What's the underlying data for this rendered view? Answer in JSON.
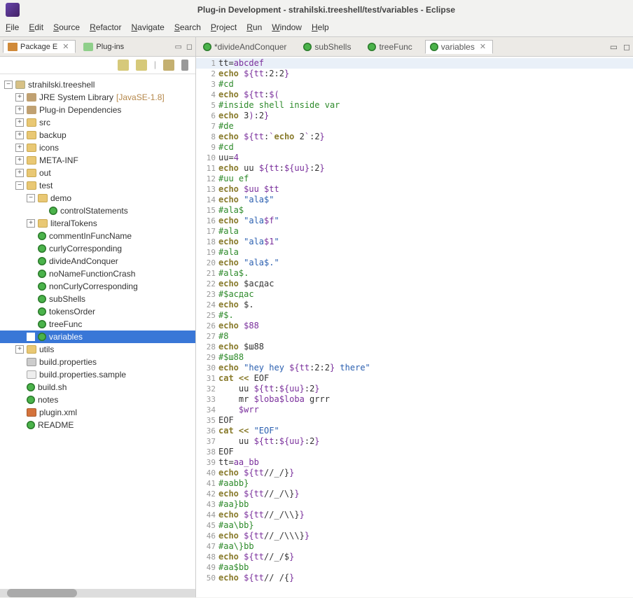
{
  "title": "Plug-in Development - strahilski.treeshell/test/variables - Eclipse",
  "menu": [
    "File",
    "Edit",
    "Source",
    "Refactor",
    "Navigate",
    "Search",
    "Project",
    "Run",
    "Window",
    "Help"
  ],
  "sidebar": {
    "tabs": [
      {
        "label": "Package E",
        "active": true
      },
      {
        "label": "Plug-ins",
        "active": false
      }
    ],
    "root": "strahilski.treeshell",
    "jre": {
      "label": "JRE System Library",
      "suffix": "[JavaSE-1.8]"
    },
    "plugin_dep": "Plug-in Dependencies",
    "folders": [
      "src",
      "backup",
      "icons",
      "META-INF",
      "out",
      "test"
    ],
    "demo": "demo",
    "demo_child": "controlStatements",
    "literal": "literalTokens",
    "test_files": [
      "commentInFuncName",
      "curlyCorresponding",
      "divideAndConquer",
      "noNameFunctionCrash",
      "nonCurlyCorresponding",
      "subShells",
      "tokensOrder",
      "treeFunc",
      "variables"
    ],
    "utils": "utils",
    "root_files": [
      {
        "label": "build.properties",
        "type": "prop"
      },
      {
        "label": "build.properties.sample",
        "type": "file"
      },
      {
        "label": "build.sh",
        "type": "leaf"
      },
      {
        "label": "notes",
        "type": "leaf"
      },
      {
        "label": "plugin.xml",
        "type": "xml"
      },
      {
        "label": "README",
        "type": "leaf"
      }
    ]
  },
  "editor_tabs": [
    {
      "label": "*divideAndConquer",
      "active": false
    },
    {
      "label": "subShells",
      "active": false
    },
    {
      "label": "treeFunc",
      "active": false
    },
    {
      "label": "variables",
      "active": true
    }
  ],
  "code": [
    {
      "n": 1,
      "hl": true,
      "segs": [
        {
          "t": "tt",
          "c": "plain"
        },
        {
          "t": "=",
          "c": "plain"
        },
        {
          "t": "abcdef",
          "c": "var"
        }
      ]
    },
    {
      "n": 2,
      "segs": [
        {
          "t": "echo ",
          "c": "cmd"
        },
        {
          "t": "${tt",
          "c": "var"
        },
        {
          "t": ":2:2",
          "c": "plain"
        },
        {
          "t": "}",
          "c": "var"
        }
      ]
    },
    {
      "n": 3,
      "segs": [
        {
          "t": "#cd",
          "c": "com"
        }
      ]
    },
    {
      "n": 4,
      "segs": [
        {
          "t": "echo ",
          "c": "cmd"
        },
        {
          "t": "${tt",
          "c": "var"
        },
        {
          "t": ":",
          "c": "plain"
        },
        {
          "t": "$(",
          "c": "var"
        }
      ]
    },
    {
      "n": 5,
      "segs": [
        {
          "t": "#inside shell inside var",
          "c": "com"
        }
      ]
    },
    {
      "n": 6,
      "segs": [
        {
          "t": "echo ",
          "c": "cmd"
        },
        {
          "t": "3",
          "c": "plain"
        },
        {
          "t": ")",
          "c": "var"
        },
        {
          "t": ":2",
          "c": "plain"
        },
        {
          "t": "}",
          "c": "var"
        }
      ]
    },
    {
      "n": 7,
      "segs": [
        {
          "t": "#de",
          "c": "com"
        }
      ]
    },
    {
      "n": 8,
      "segs": [
        {
          "t": "echo ",
          "c": "cmd"
        },
        {
          "t": "${tt",
          "c": "var"
        },
        {
          "t": ":",
          "c": "plain"
        },
        {
          "t": "`",
          "c": "var"
        },
        {
          "t": "echo ",
          "c": "cmd"
        },
        {
          "t": "2",
          "c": "plain"
        },
        {
          "t": "`",
          "c": "var"
        },
        {
          "t": ":2",
          "c": "plain"
        },
        {
          "t": "}",
          "c": "var"
        }
      ]
    },
    {
      "n": 9,
      "segs": [
        {
          "t": "#cd",
          "c": "com"
        }
      ]
    },
    {
      "n": 10,
      "segs": [
        {
          "t": "uu",
          "c": "plain"
        },
        {
          "t": "=",
          "c": "plain"
        },
        {
          "t": "4",
          "c": "var"
        }
      ]
    },
    {
      "n": 11,
      "segs": [
        {
          "t": "echo ",
          "c": "cmd"
        },
        {
          "t": "uu ",
          "c": "plain"
        },
        {
          "t": "${tt",
          "c": "var"
        },
        {
          "t": ":",
          "c": "plain"
        },
        {
          "t": "${uu}",
          "c": "var"
        },
        {
          "t": ":2",
          "c": "plain"
        },
        {
          "t": "}",
          "c": "var"
        }
      ]
    },
    {
      "n": 12,
      "segs": [
        {
          "t": "#uu ef",
          "c": "com"
        }
      ]
    },
    {
      "n": 13,
      "segs": [
        {
          "t": "echo ",
          "c": "cmd"
        },
        {
          "t": "$uu $tt",
          "c": "var"
        }
      ]
    },
    {
      "n": 14,
      "segs": [
        {
          "t": "echo ",
          "c": "cmd"
        },
        {
          "t": "\"ala$\"",
          "c": "str"
        }
      ]
    },
    {
      "n": 15,
      "segs": [
        {
          "t": "#ala$",
          "c": "com"
        }
      ]
    },
    {
      "n": 16,
      "segs": [
        {
          "t": "echo ",
          "c": "cmd"
        },
        {
          "t": "\"ala",
          "c": "str"
        },
        {
          "t": "$f",
          "c": "var"
        },
        {
          "t": "\"",
          "c": "str"
        }
      ]
    },
    {
      "n": 17,
      "segs": [
        {
          "t": "#ala",
          "c": "com"
        }
      ]
    },
    {
      "n": 18,
      "segs": [
        {
          "t": "echo ",
          "c": "cmd"
        },
        {
          "t": "\"ala",
          "c": "str"
        },
        {
          "t": "$1",
          "c": "var"
        },
        {
          "t": "\"",
          "c": "str"
        }
      ]
    },
    {
      "n": 19,
      "segs": [
        {
          "t": "#ala",
          "c": "com"
        }
      ]
    },
    {
      "n": 20,
      "segs": [
        {
          "t": "echo ",
          "c": "cmd"
        },
        {
          "t": "\"ala$.\"",
          "c": "str"
        }
      ]
    },
    {
      "n": 21,
      "segs": [
        {
          "t": "#ala$.",
          "c": "com"
        }
      ]
    },
    {
      "n": 22,
      "segs": [
        {
          "t": "echo ",
          "c": "cmd"
        },
        {
          "t": "$асдас",
          "c": "plain"
        }
      ]
    },
    {
      "n": 23,
      "segs": [
        {
          "t": "#$асдас",
          "c": "com"
        }
      ]
    },
    {
      "n": 24,
      "segs": [
        {
          "t": "echo ",
          "c": "cmd"
        },
        {
          "t": "$.",
          "c": "plain"
        }
      ]
    },
    {
      "n": 25,
      "segs": [
        {
          "t": "#$.",
          "c": "com"
        }
      ]
    },
    {
      "n": 26,
      "segs": [
        {
          "t": "echo ",
          "c": "cmd"
        },
        {
          "t": "$88",
          "c": "var"
        }
      ]
    },
    {
      "n": 27,
      "segs": [
        {
          "t": "#8",
          "c": "com"
        }
      ]
    },
    {
      "n": 28,
      "segs": [
        {
          "t": "echo ",
          "c": "cmd"
        },
        {
          "t": "$ш88",
          "c": "plain"
        }
      ]
    },
    {
      "n": 29,
      "segs": [
        {
          "t": "#$ш88",
          "c": "com"
        }
      ]
    },
    {
      "n": 30,
      "segs": [
        {
          "t": "echo ",
          "c": "cmd"
        },
        {
          "t": "\"hey hey ",
          "c": "str"
        },
        {
          "t": "${tt",
          "c": "var"
        },
        {
          "t": ":2:2",
          "c": "plain"
        },
        {
          "t": "}",
          "c": "var"
        },
        {
          "t": " there\"",
          "c": "str"
        }
      ]
    },
    {
      "n": 31,
      "segs": [
        {
          "t": "cat << ",
          "c": "cmd"
        },
        {
          "t": "EOF",
          "c": "plain"
        }
      ]
    },
    {
      "n": 32,
      "segs": [
        {
          "t": "    uu ",
          "c": "plain"
        },
        {
          "t": "${tt",
          "c": "var"
        },
        {
          "t": ":",
          "c": "plain"
        },
        {
          "t": "${uu}",
          "c": "var"
        },
        {
          "t": ":2",
          "c": "plain"
        },
        {
          "t": "}",
          "c": "var"
        }
      ]
    },
    {
      "n": 33,
      "segs": [
        {
          "t": "    mr ",
          "c": "plain"
        },
        {
          "t": "$loba$loba",
          "c": "var"
        },
        {
          "t": " grrr",
          "c": "plain"
        }
      ]
    },
    {
      "n": 34,
      "segs": [
        {
          "t": "    ",
          "c": "plain"
        },
        {
          "t": "$wrr",
          "c": "var"
        }
      ]
    },
    {
      "n": 35,
      "segs": [
        {
          "t": "EOF",
          "c": "plain"
        }
      ]
    },
    {
      "n": 36,
      "segs": [
        {
          "t": "cat << ",
          "c": "cmd"
        },
        {
          "t": "\"EOF\"",
          "c": "str"
        }
      ]
    },
    {
      "n": 37,
      "segs": [
        {
          "t": "    uu ",
          "c": "plain"
        },
        {
          "t": "${tt",
          "c": "var"
        },
        {
          "t": ":",
          "c": "plain"
        },
        {
          "t": "${uu}",
          "c": "var"
        },
        {
          "t": ":2",
          "c": "plain"
        },
        {
          "t": "}",
          "c": "var"
        }
      ]
    },
    {
      "n": 38,
      "segs": [
        {
          "t": "EOF",
          "c": "plain"
        }
      ]
    },
    {
      "n": 39,
      "segs": [
        {
          "t": "tt",
          "c": "plain"
        },
        {
          "t": "=",
          "c": "plain"
        },
        {
          "t": "aa_bb",
          "c": "var"
        }
      ]
    },
    {
      "n": 40,
      "segs": [
        {
          "t": "echo ",
          "c": "cmd"
        },
        {
          "t": "${tt",
          "c": "var"
        },
        {
          "t": "//_/}",
          "c": "plain"
        },
        {
          "t": "}",
          "c": "var"
        }
      ]
    },
    {
      "n": 41,
      "segs": [
        {
          "t": "#aabb}",
          "c": "com"
        }
      ]
    },
    {
      "n": 42,
      "segs": [
        {
          "t": "echo ",
          "c": "cmd"
        },
        {
          "t": "${tt",
          "c": "var"
        },
        {
          "t": "//_/\\}",
          "c": "plain"
        },
        {
          "t": "}",
          "c": "var"
        }
      ]
    },
    {
      "n": 43,
      "segs": [
        {
          "t": "#aa}bb",
          "c": "com"
        }
      ]
    },
    {
      "n": 44,
      "segs": [
        {
          "t": "echo ",
          "c": "cmd"
        },
        {
          "t": "${tt",
          "c": "var"
        },
        {
          "t": "//_/\\\\}",
          "c": "plain"
        },
        {
          "t": "}",
          "c": "var"
        }
      ]
    },
    {
      "n": 45,
      "segs": [
        {
          "t": "#aa\\bb}",
          "c": "com"
        }
      ]
    },
    {
      "n": 46,
      "segs": [
        {
          "t": "echo ",
          "c": "cmd"
        },
        {
          "t": "${tt",
          "c": "var"
        },
        {
          "t": "//_/\\\\\\}",
          "c": "plain"
        },
        {
          "t": "}",
          "c": "var"
        }
      ]
    },
    {
      "n": 47,
      "segs": [
        {
          "t": "#aa\\}bb",
          "c": "com"
        }
      ]
    },
    {
      "n": 48,
      "segs": [
        {
          "t": "echo ",
          "c": "cmd"
        },
        {
          "t": "${tt",
          "c": "var"
        },
        {
          "t": "//_/$",
          "c": "plain"
        },
        {
          "t": "}",
          "c": "var"
        }
      ]
    },
    {
      "n": 49,
      "segs": [
        {
          "t": "#aa$bb",
          "c": "com"
        }
      ]
    },
    {
      "n": 50,
      "segs": [
        {
          "t": "echo ",
          "c": "cmd"
        },
        {
          "t": "${tt",
          "c": "var"
        },
        {
          "t": "// /{",
          "c": "plain"
        },
        {
          "t": "}",
          "c": "var"
        }
      ]
    }
  ]
}
